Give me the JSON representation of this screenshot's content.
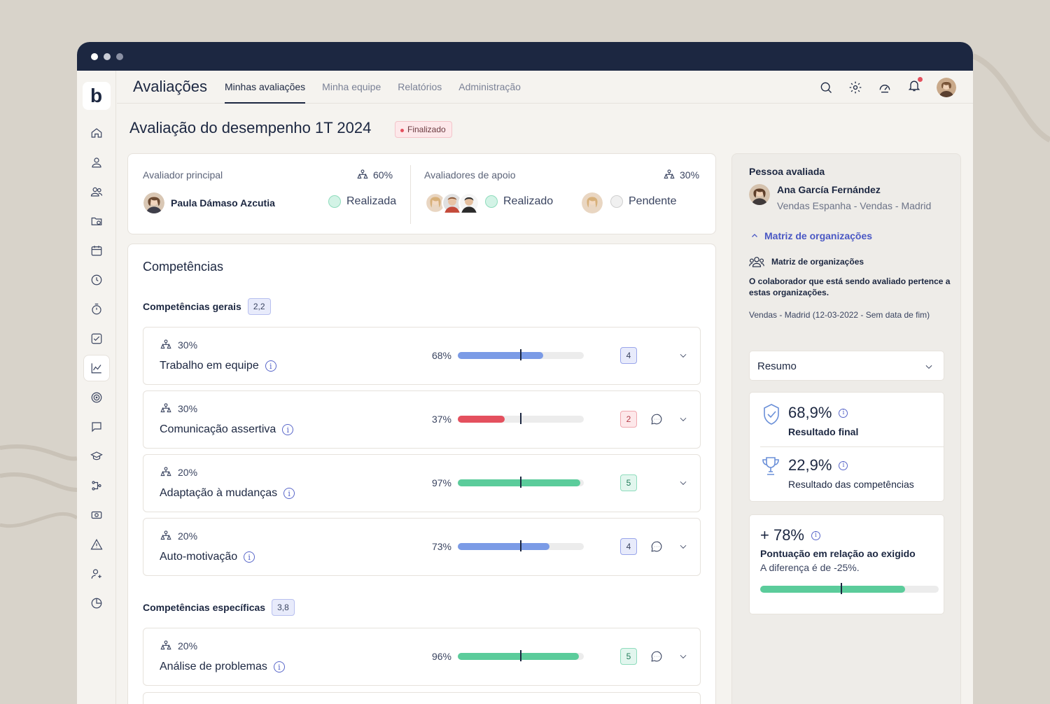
{
  "app": {
    "title": "Avaliações",
    "logo": "b"
  },
  "tabs": [
    {
      "label": "Minhas avaliações",
      "active": true
    },
    {
      "label": "Minha equipe"
    },
    {
      "label": "Relatórios"
    },
    {
      "label": "Administração"
    }
  ],
  "top_icons": [
    "search-icon",
    "gear-icon",
    "gauge-icon",
    "bell-icon"
  ],
  "sidebar_icons": [
    "home-icon",
    "user-icon",
    "users-icon",
    "folder-icon",
    "calendar-icon",
    "clock-icon",
    "stopwatch-icon",
    "checkbox-icon",
    "chart-icon",
    "target-icon",
    "chat-icon",
    "graduation-icon",
    "workflow-icon",
    "money-icon",
    "warning-icon",
    "user-plus-icon",
    "pie-icon"
  ],
  "page": {
    "title": "Avaliação do desempenho 1T 2024",
    "status": "Finalizado"
  },
  "evaluators": {
    "main_label": "Avaliador principal",
    "main_weight": "60%",
    "main_name": "Paula Dámaso Azcutia",
    "main_status": "Realizada",
    "support_label": "Avaliadores de apoio",
    "support_weight": "30%",
    "support_done": "Realizado",
    "support_pending": "Pendente"
  },
  "competencias": {
    "title": "Competências",
    "general_label": "Competências gerais",
    "general_score": "2,2",
    "specific_label": "Competências específicas",
    "specific_score": "3,8",
    "rows": [
      {
        "weight": "30%",
        "name": "Trabalho em equipe",
        "pct": "68%",
        "value": 68,
        "level": "4",
        "color": "#7b9be6",
        "chat": false
      },
      {
        "weight": "30%",
        "name": "Comunicação assertiva",
        "pct": "37%",
        "value": 37,
        "level": "2",
        "color": "#e4505e",
        "chat": true
      },
      {
        "weight": "20%",
        "name": "Adaptação à mudanças",
        "pct": "97%",
        "value": 97,
        "level": "5",
        "color": "#5bcc9b",
        "chat": false
      },
      {
        "weight": "20%",
        "name": "Auto-motivação",
        "pct": "73%",
        "value": 73,
        "level": "4",
        "color": "#7b9be6",
        "chat": true
      },
      {
        "weight": "20%",
        "name": "Análise de problemas",
        "pct": "96%",
        "value": 96,
        "level": "5",
        "color": "#5bcc9b",
        "chat": true
      }
    ]
  },
  "person": {
    "title": "Pessoa avaliada",
    "name": "Ana García Fernández",
    "sub": "Vendas Espanha - Vendas - Madrid",
    "link": "Matriz de organizações",
    "matrix_title": "Matriz de organizações",
    "matrix_desc": "O colaborador que está sendo avaliado pertence a estas organizações.",
    "org": "Vendas - Madrid (12-03-2022 - Sem data de fim)"
  },
  "summary": {
    "select": "Resumo",
    "final_value": "68,9%",
    "final_label": "Resultado final",
    "comp_value": "22,9%",
    "comp_label": "Resultado das competências",
    "pont_value": "+ 78%",
    "pont_label": "Pontuação em relação ao exigido",
    "pont_diff": "A diferença é de -25%.",
    "pont_fill": 0.81,
    "pont_marker": 0.45
  }
}
